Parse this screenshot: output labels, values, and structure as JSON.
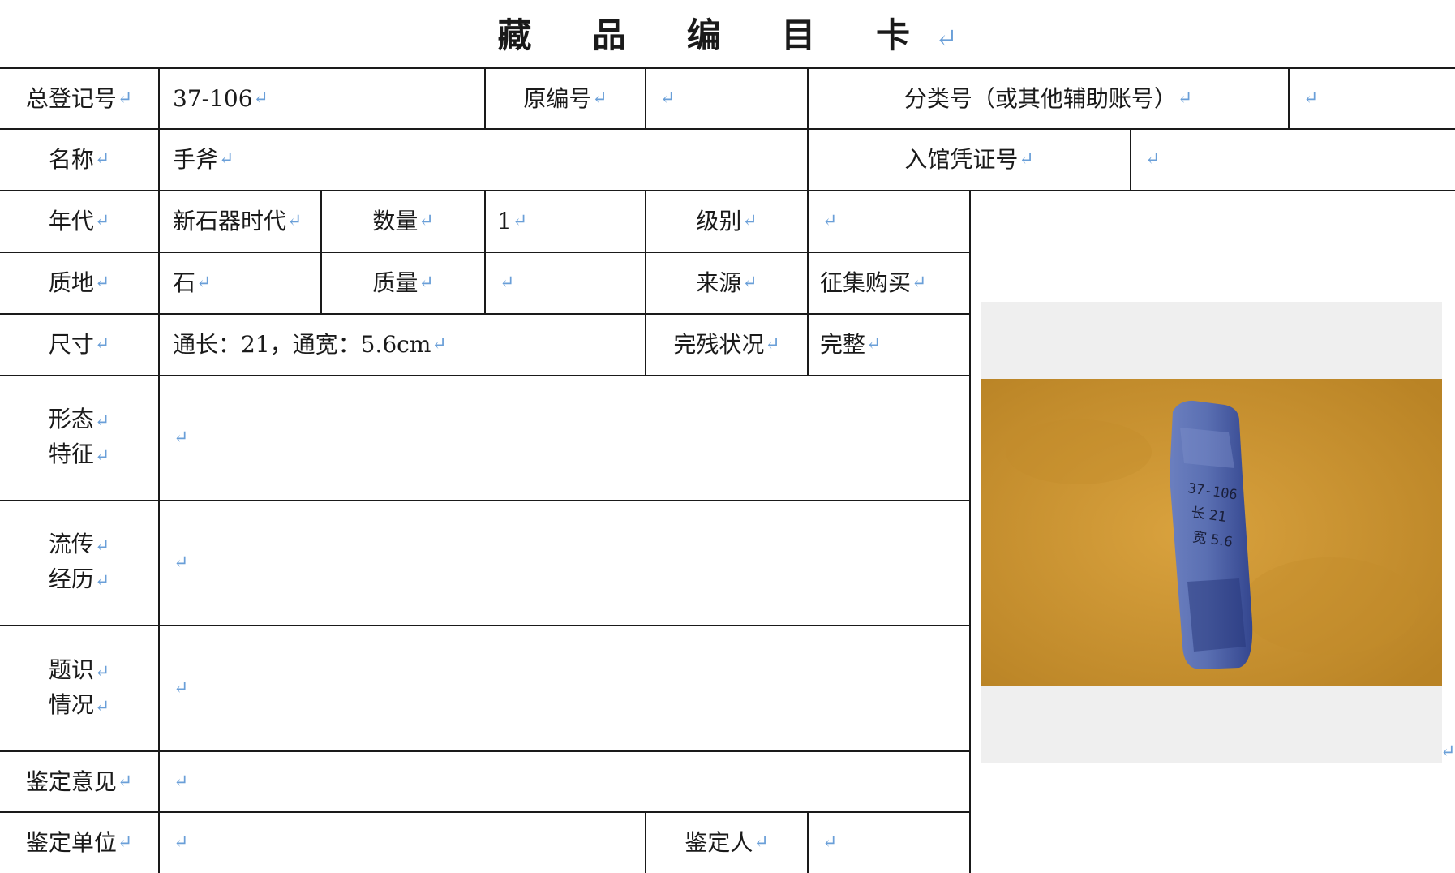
{
  "card": {
    "title": "藏 品 编 目 卡",
    "mark": "↵"
  },
  "labels": {
    "total_reg": "总登记号",
    "orig_no": "原编号",
    "class_no": "分类号（或其他辅助账号）",
    "name": "名称",
    "voucher": "入馆凭证号",
    "era": "年代",
    "quantity": "数量",
    "grade": "级别",
    "material": "质地",
    "mass": "质量",
    "source": "来源",
    "size": "尺寸",
    "condition": "完残状况",
    "form_1": "形态",
    "form_2": "特征",
    "history_1": "流传",
    "history_2": "经历",
    "inscription_1": "题识",
    "inscription_2": "情况",
    "appraisal_opinion": "鉴定意见",
    "appraisal_unit": "鉴定单位",
    "appraiser": "鉴定人"
  },
  "values": {
    "total_reg": "37-106",
    "orig_no": "",
    "class_no": "",
    "name": "手斧",
    "voucher": "",
    "era": "新石器时代",
    "quantity": "1",
    "grade": "",
    "material": "石",
    "mass": "",
    "source": "征集购买",
    "size": "通长：21，通宽：5.6cm",
    "condition": "完整",
    "form": "",
    "history": "",
    "inscription": "",
    "appraisal_opinion": "",
    "appraisal_unit": "",
    "appraiser": ""
  },
  "photo": {
    "inscription_lines": [
      "37-106",
      "长 21",
      "宽 5.6"
    ],
    "background_color": "#c9902e",
    "object_color": "#5468a8"
  }
}
